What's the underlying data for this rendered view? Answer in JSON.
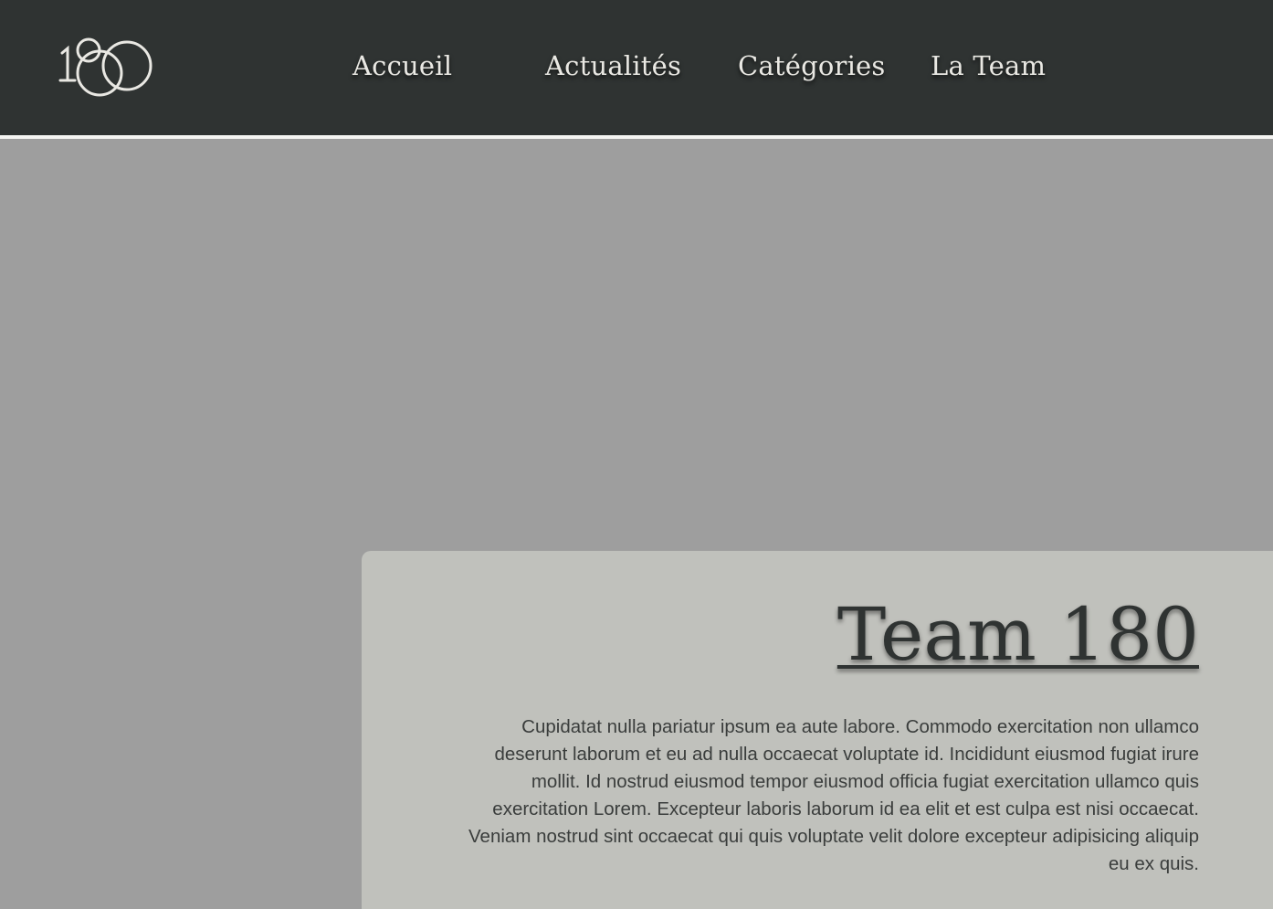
{
  "header": {
    "logo_alt": "180",
    "nav": [
      {
        "label": "Accueil"
      },
      {
        "label": "Actualités"
      },
      {
        "label": "Catégories"
      },
      {
        "label": "La Team"
      }
    ]
  },
  "hero": {
    "card": {
      "title": "Team 180",
      "body": "Cupidatat nulla pariatur ipsum ea aute labore. Commodo exercitation non ullamco deserunt laborum et eu ad nulla occaecat voluptate id. Incididunt eiusmod fugiat irure mollit. Id nostrud  eiusmod tempor eiusmod officia fugiat exercitation ullamco quis exercitation Lorem. Excepteur laboris laborum id ea elit et est culpa est nisi occaecat. Veniam nostrud sint occaecat qui quis voluptate velit dolore excepteur adipisicing aliquip eu ex quis."
    }
  },
  "colors": {
    "header_bg": "#2f3332",
    "hero_bg": "#9e9e9e",
    "card_bg": "#c0c1bc",
    "nav_text": "#e9e8e3",
    "title_text": "#2f3332"
  }
}
